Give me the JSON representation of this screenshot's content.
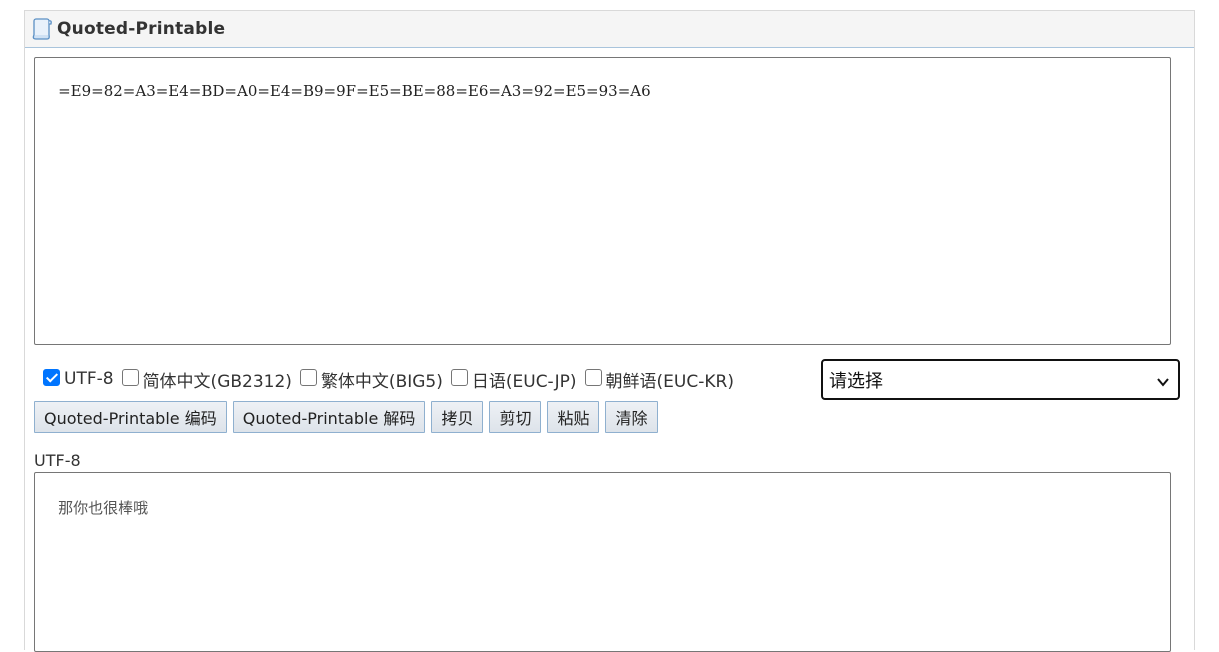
{
  "header": {
    "title": "Quoted-Printable",
    "icon": "scroll-icon"
  },
  "input": {
    "value": "=E9=82=A3=E4=BD=A0=E4=B9=9F=E5=BE=88=E6=A3=92=E5=93=A6"
  },
  "charsets": [
    {
      "label": "UTF-8",
      "checked": true
    },
    {
      "label": "简体中文(GB2312)",
      "checked": false
    },
    {
      "label": "繁体中文(BIG5)",
      "checked": false
    },
    {
      "label": "日语(EUC-JP)",
      "checked": false
    },
    {
      "label": "朝鲜语(EUC-KR)",
      "checked": false
    }
  ],
  "select": {
    "value": "请选择"
  },
  "buttons": {
    "encode": "Quoted-Printable 编码",
    "decode": "Quoted-Printable 解码",
    "copy": "拷贝",
    "cut": "剪切",
    "paste": "粘贴",
    "clear": "清除"
  },
  "output": {
    "label": "UTF-8",
    "value": "那你也很棒哦"
  },
  "colors": {
    "accent": "#0075ff",
    "button_border": "#8fb0cf",
    "header_border": "#a9c4dc"
  }
}
